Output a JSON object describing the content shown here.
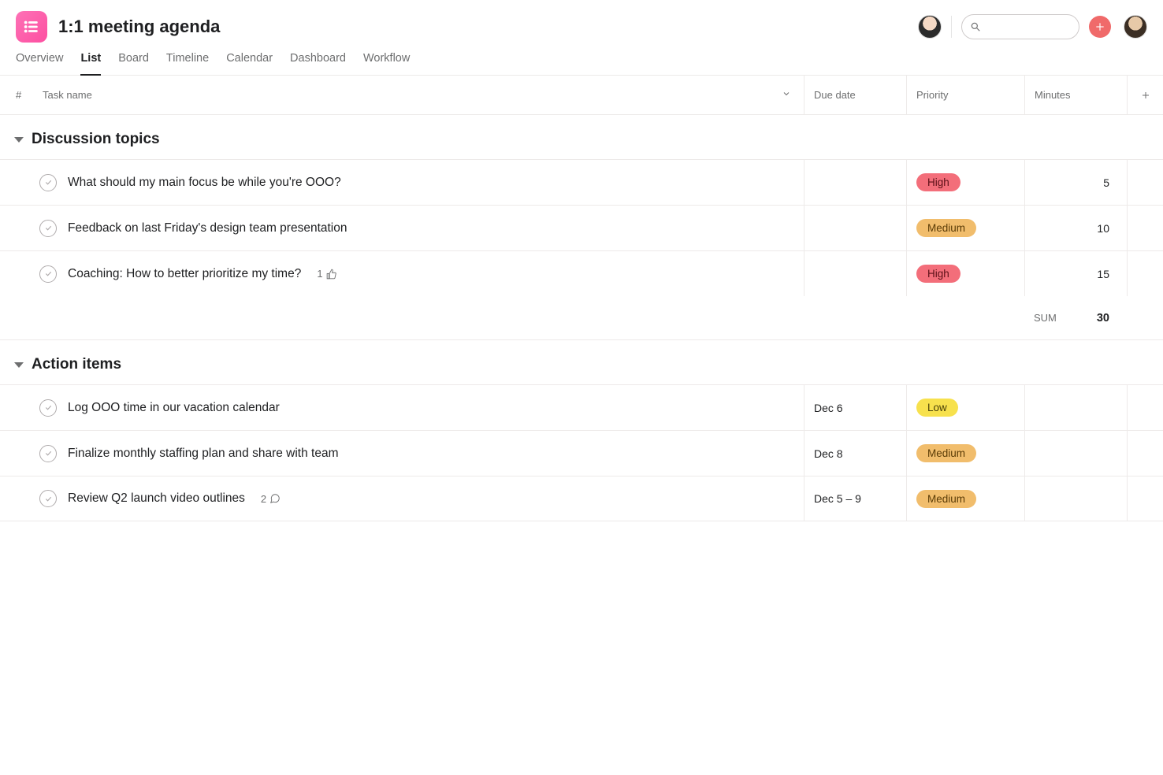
{
  "header": {
    "title": "1:1 meeting agenda"
  },
  "tabs": [
    "Overview",
    "List",
    "Board",
    "Timeline",
    "Calendar",
    "Dashboard",
    "Workflow"
  ],
  "active_tab": "List",
  "columns": {
    "num": "#",
    "task": "Task name",
    "due": "Due date",
    "priority": "Priority",
    "minutes": "Minutes"
  },
  "priority_colors": {
    "High": "high",
    "Medium": "medium",
    "Low": "low"
  },
  "sections": [
    {
      "title": "Discussion topics",
      "tasks": [
        {
          "name": "What should my main focus be while you're OOO?",
          "due": "",
          "priority": "High",
          "minutes": "5",
          "likes": null,
          "comments": null
        },
        {
          "name": "Feedback on last Friday's design team presentation",
          "due": "",
          "priority": "Medium",
          "minutes": "10",
          "likes": null,
          "comments": null
        },
        {
          "name": "Coaching: How to better prioritize my time?",
          "due": "",
          "priority": "High",
          "minutes": "15",
          "likes": "1",
          "comments": null
        }
      ],
      "sum_label": "SUM",
      "sum_value": "30"
    },
    {
      "title": "Action items",
      "tasks": [
        {
          "name": "Log OOO time in our vacation calendar",
          "due": "Dec 6",
          "priority": "Low",
          "minutes": "",
          "likes": null,
          "comments": null
        },
        {
          "name": "Finalize monthly staffing plan and share with team",
          "due": "Dec 8",
          "priority": "Medium",
          "minutes": "",
          "likes": null,
          "comments": null
        },
        {
          "name": "Review Q2 launch video outlines",
          "due": "Dec 5 – 9",
          "priority": "Medium",
          "minutes": "",
          "likes": null,
          "comments": "2"
        }
      ],
      "sum_label": null,
      "sum_value": null
    }
  ]
}
